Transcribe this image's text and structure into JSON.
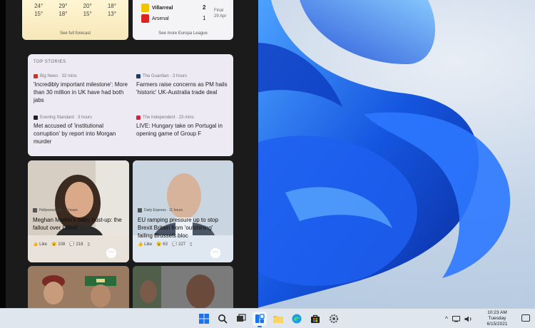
{
  "weather": {
    "highs": [
      "24°",
      "29°",
      "20°",
      "18°"
    ],
    "lows": [
      "15°",
      "18°",
      "15°",
      "13°"
    ],
    "link_label": "See full forecast"
  },
  "sports": {
    "team1": "Villarreal",
    "team2": "Arsenal",
    "score1": "2",
    "score2": "1",
    "status": "Final",
    "date": "29 Apr",
    "link_label": "See more Europa League"
  },
  "top_stories": {
    "header": "TOP STORIES",
    "items": [
      {
        "source": "Big News · 32 mins",
        "title": "'Incredibly important milestone': More than 30 million in UK have had both jabs",
        "logo_color": "#c0392b"
      },
      {
        "source": "The Guardian · 3 hours",
        "title": "Farmers raise concerns as PM hails 'historic' UK-Australia trade deal",
        "logo_color": "#1f3b6b"
      },
      {
        "source": "Evening Standard · 3 hours",
        "title": "Met accused of 'institutional corruption' by report into Morgan murder",
        "logo_color": "#222222"
      },
      {
        "source": "The Independent · 23 mins",
        "title": "LIVE: Hungary take on Portugal in opening game of Group F",
        "logo_color": "#d0253b"
      }
    ]
  },
  "news_cards": [
    {
      "source": "Hollywood Life · 2 hours",
      "title": "Meghan Markle's baby bust-up: the fallout over Lilibet",
      "like_label": "Like",
      "reactions": "108",
      "comments": "218"
    },
    {
      "source": "Daily Express · 11 hours",
      "title": "EU ramping pressure up to stop Brexit Britain from 'outshining' failing Brussels bloc",
      "like_label": "Like",
      "reactions": "63",
      "comments": "227"
    }
  ],
  "taskbar": {
    "time": "10:23 AM",
    "day": "Tuesday",
    "date": "6/15/2021"
  }
}
